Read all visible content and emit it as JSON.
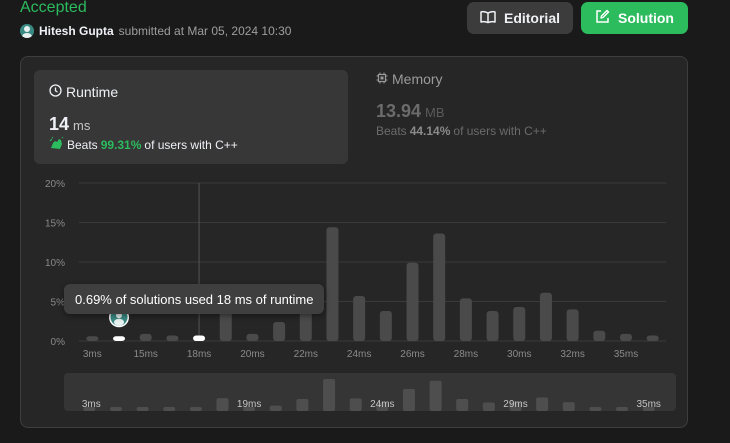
{
  "header": {
    "status": "Accepted",
    "author": "Hitesh Gupta",
    "submitted_text": "submitted at Mar 05, 2024 10:30",
    "editorial_label": "Editorial",
    "solution_label": "Solution"
  },
  "runtime": {
    "title": "Runtime",
    "value": "14",
    "unit": "ms",
    "beats_prefix": "Beats",
    "beats_pct": "99.31%",
    "beats_suffix": "of users with C++"
  },
  "memory": {
    "title": "Memory",
    "value": "13.94",
    "unit": "MB",
    "beats_prefix": "Beats",
    "beats_pct": "44.14%",
    "beats_suffix": "of users with C++"
  },
  "tooltip": {
    "text": "0.69% of solutions used 18 ms of runtime"
  },
  "colors": {
    "accent_green": "#2cbb5d",
    "bar": "#4a4a4a",
    "highlight": "#ffffff"
  },
  "chart_data": {
    "type": "bar",
    "y_axis_labels": [
      "20%",
      "15%",
      "10%",
      "5%",
      "0%"
    ],
    "ylim": [
      0,
      20
    ],
    "x_axis_labels": [
      "3ms",
      "15ms",
      "18ms",
      "20ms",
      "22ms",
      "24ms",
      "26ms",
      "28ms",
      "30ms",
      "32ms",
      "35ms"
    ],
    "values": [
      0.6,
      0.6,
      0.9,
      0.7,
      0.69,
      5.8,
      0.9,
      2.4,
      5.4,
      14.4,
      5.7,
      3.8,
      9.9,
      13.6,
      5.4,
      3.8,
      4.3,
      6.1,
      4.0,
      1.3,
      0.9,
      0.7
    ],
    "user_bar_index": 1,
    "highlight_indices": [
      1,
      4
    ],
    "hover_index": 4,
    "brush_labels": [
      "3ms",
      "19ms",
      "24ms",
      "29ms",
      "35ms"
    ]
  }
}
